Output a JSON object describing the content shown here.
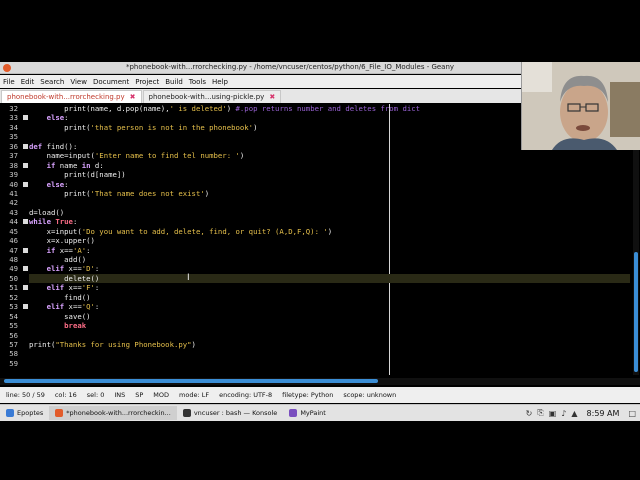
{
  "window": {
    "title": "*phonebook-with...rrorchecking.py - /home/vncuser/centos/python/6_File_IO_Modules - Geany"
  },
  "menu": [
    "File",
    "Edit",
    "Search",
    "View",
    "Document",
    "Project",
    "Build",
    "Tools",
    "Help"
  ],
  "tabs": [
    {
      "label": "phonebook-with...rrorchecking.py",
      "active": true
    },
    {
      "label": "phonebook-with...using-pickle.py",
      "active": false
    }
  ],
  "code_lines": [
    {
      "n": "32",
      "html": "        <span class='idt'>print(name, d.pop(name),</span><span class='str'>' is deleted'</span><span class='idt'>) </span><span class='cm'>#.pop returns number and deletes from dict</span>",
      "fold": false
    },
    {
      "n": "33",
      "html": "    <span class='kw'>else</span><span class='idt'>:</span>",
      "fold": true
    },
    {
      "n": "34",
      "html": "        <span class='idt'>print(</span><span class='str'>'that person is not in the phonebook'</span><span class='idt'>)</span>",
      "fold": false
    },
    {
      "n": "35",
      "html": "",
      "fold": false
    },
    {
      "n": "36",
      "html": "<span class='kw'>def</span><span class='idt'> find():</span>",
      "fold": true
    },
    {
      "n": "37",
      "html": "    <span class='idt'>name=input(</span><span class='str'>'Enter name to find tel number: '</span><span class='idt'>)</span>",
      "fold": false
    },
    {
      "n": "38",
      "html": "    <span class='kw'>if</span><span class='idt'> name </span><span class='kw'>in</span><span class='idt'> d:</span>",
      "fold": true
    },
    {
      "n": "39",
      "html": "        <span class='idt'>print(d[name])</span>",
      "fold": false
    },
    {
      "n": "40",
      "html": "    <span class='kw'>else</span><span class='idt'>:</span>",
      "fold": true
    },
    {
      "n": "41",
      "html": "        <span class='idt'>print(</span><span class='str'>'That name does not exist'</span><span class='idt'>)</span>",
      "fold": false
    },
    {
      "n": "42",
      "html": "",
      "fold": false
    },
    {
      "n": "43",
      "html": "<span class='idt'>d=load()</span>",
      "fold": false
    },
    {
      "n": "44",
      "html": "<span class='kw'>while</span><span class='idt'> </span><span class='kw2'>True</span><span class='idt'>:</span>",
      "fold": true
    },
    {
      "n": "45",
      "html": "    <span class='idt'>x=input(</span><span class='str'>'Do you want to add, delete, find, or quit? (A,D,F,Q): '</span><span class='idt'>)</span>",
      "fold": false
    },
    {
      "n": "46",
      "html": "    <span class='idt'>x=x.upper()</span>",
      "fold": false
    },
    {
      "n": "47",
      "html": "    <span class='kw'>if</span><span class='idt'> x==</span><span class='str'>'A'</span><span class='idt'>:</span>",
      "fold": true
    },
    {
      "n": "48",
      "html": "        <span class='idt'>add()</span>",
      "fold": false
    },
    {
      "n": "49",
      "html": "    <span class='kw'>elif</span><span class='idt'> x==</span><span class='str'>'D'</span><span class='idt'>:</span>",
      "fold": true
    },
    {
      "n": "50",
      "html": "        <span class='idt'>delete()</span>",
      "fold": false,
      "current": true
    },
    {
      "n": "51",
      "html": "    <span class='kw'>elif</span><span class='idt'> x==</span><span class='str'>'F'</span><span class='idt'>:</span>",
      "fold": true
    },
    {
      "n": "52",
      "html": "        <span class='idt'>find()</span>",
      "fold": false
    },
    {
      "n": "53",
      "html": "    <span class='kw'>elif</span><span class='idt'> x==</span><span class='str'>'Q'</span><span class='idt'>:</span>",
      "fold": true
    },
    {
      "n": "54",
      "html": "        <span class='idt'>save()</span>",
      "fold": false
    },
    {
      "n": "55",
      "html": "        <span class='kw2'>break</span>",
      "fold": false
    },
    {
      "n": "56",
      "html": "",
      "fold": false
    },
    {
      "n": "57",
      "html": "<span class='idt'>print(</span><span class='str'>\"Thanks for using Phonebook.py\"</span><span class='idt'>)</span>",
      "fold": false
    },
    {
      "n": "58",
      "html": "",
      "fold": false
    },
    {
      "n": "59",
      "html": "",
      "fold": false
    }
  ],
  "status": {
    "line": "line: 50 / 59",
    "col": "col: 16",
    "sel": "sel: 0",
    "ins": "INS",
    "sp": "SP",
    "mod": "MOD",
    "mode": "mode: LF",
    "encoding": "encoding: UTF-8",
    "filetype": "filetype: Python",
    "scope": "scope: unknown"
  },
  "taskbar": {
    "items": [
      {
        "label": "Epoptes",
        "color": "#3a7bd5",
        "active": false
      },
      {
        "label": "*phonebook-with...rrorcheckin...",
        "color": "#e25b2a",
        "active": true
      },
      {
        "label": "vncuser : bash — Konsole",
        "color": "#333333",
        "active": false
      },
      {
        "label": "MyPaint",
        "color": "#7a4fbf",
        "active": false
      }
    ],
    "clock": "8:59 AM"
  }
}
